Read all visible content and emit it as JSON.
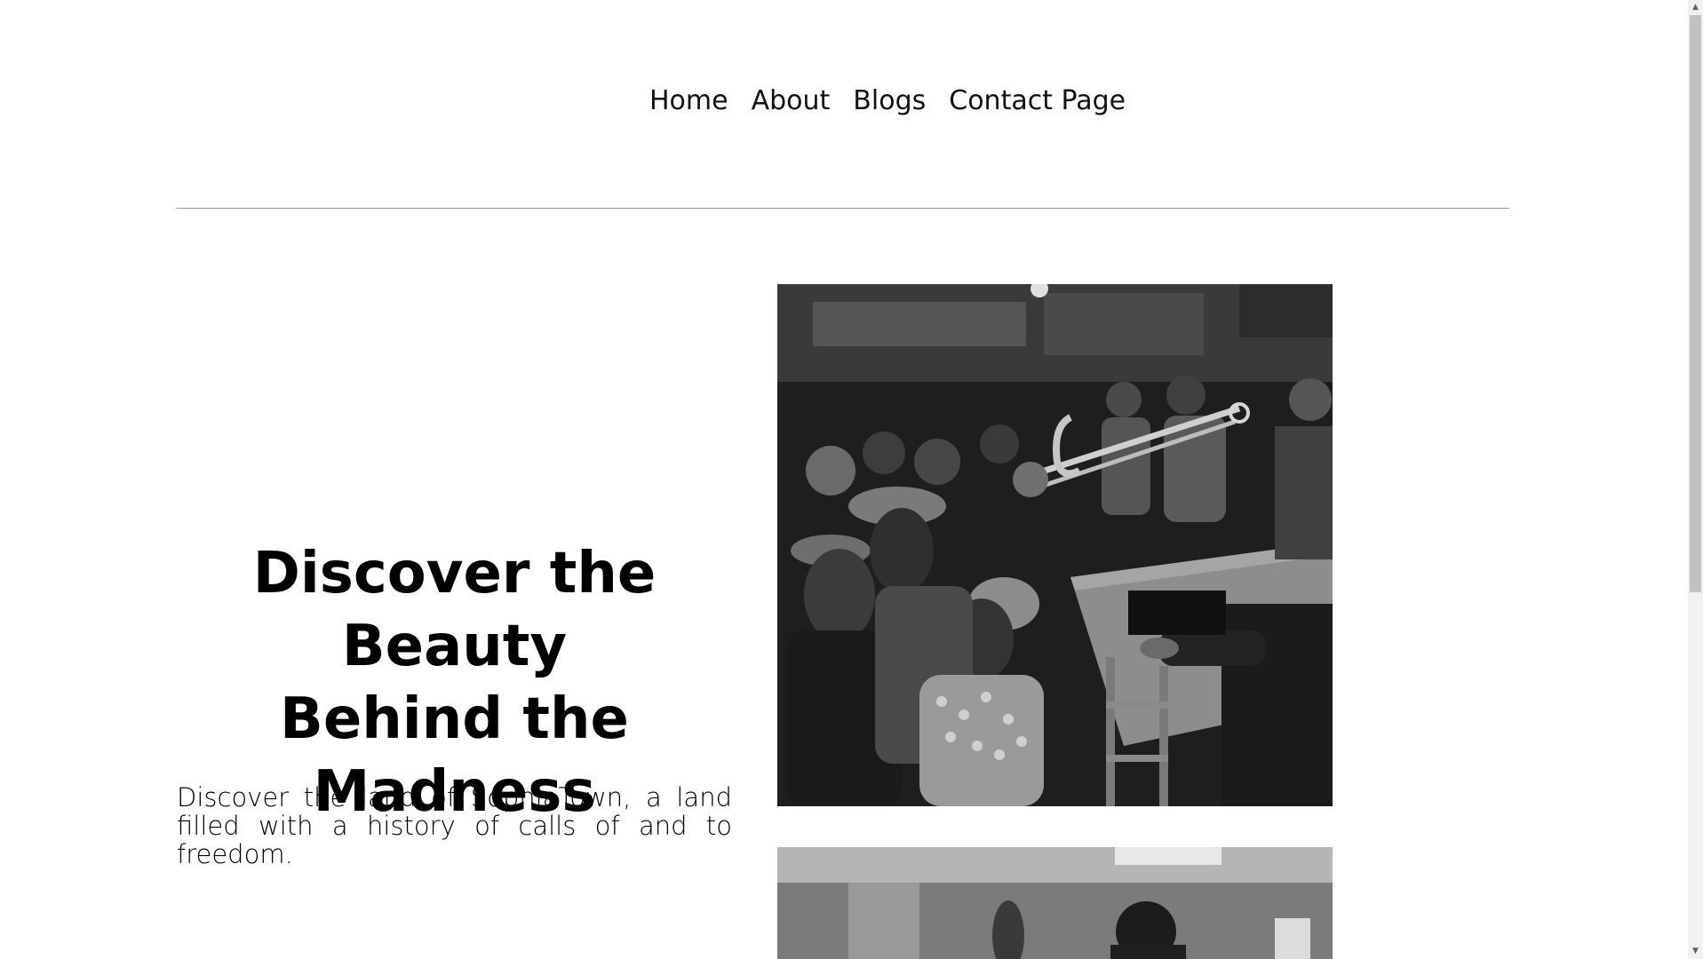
{
  "nav": {
    "items": [
      {
        "label": "Home"
      },
      {
        "label": "About"
      },
      {
        "label": "Blogs"
      },
      {
        "label": "Contact Page"
      }
    ]
  },
  "hero": {
    "title_line1": "Discover the Beauty",
    "title_line2": "Behind the Madness",
    "description": "Discover the land of SophiaTown, a land filled with a history of calls of and to freedom."
  },
  "photos": [
    {
      "name": "black-and-white photo of jazz band and crowd"
    },
    {
      "name": "black-and-white photo of musician with double bass"
    }
  ]
}
